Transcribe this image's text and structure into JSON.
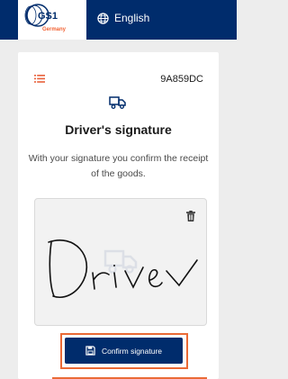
{
  "header": {
    "logo_text": "GS1",
    "logo_sub": "Germany",
    "language_label": "English"
  },
  "card": {
    "code": "9A859DC",
    "title": "Driver's signature",
    "subtitle": "With your signature you confirm the receipt of the goods.",
    "signature_text": "Driver",
    "confirm_label": "Confirm signature"
  },
  "icons": {
    "menu": "list-icon",
    "truck": "delivery-truck-icon",
    "delete": "trash-icon",
    "save": "save-icon",
    "language": "globe-icon"
  },
  "colors": {
    "header_bg": "#002c6c",
    "button_bg": "#002c6c",
    "accent": "#ea6a36",
    "brand_orange": "#f26334"
  }
}
